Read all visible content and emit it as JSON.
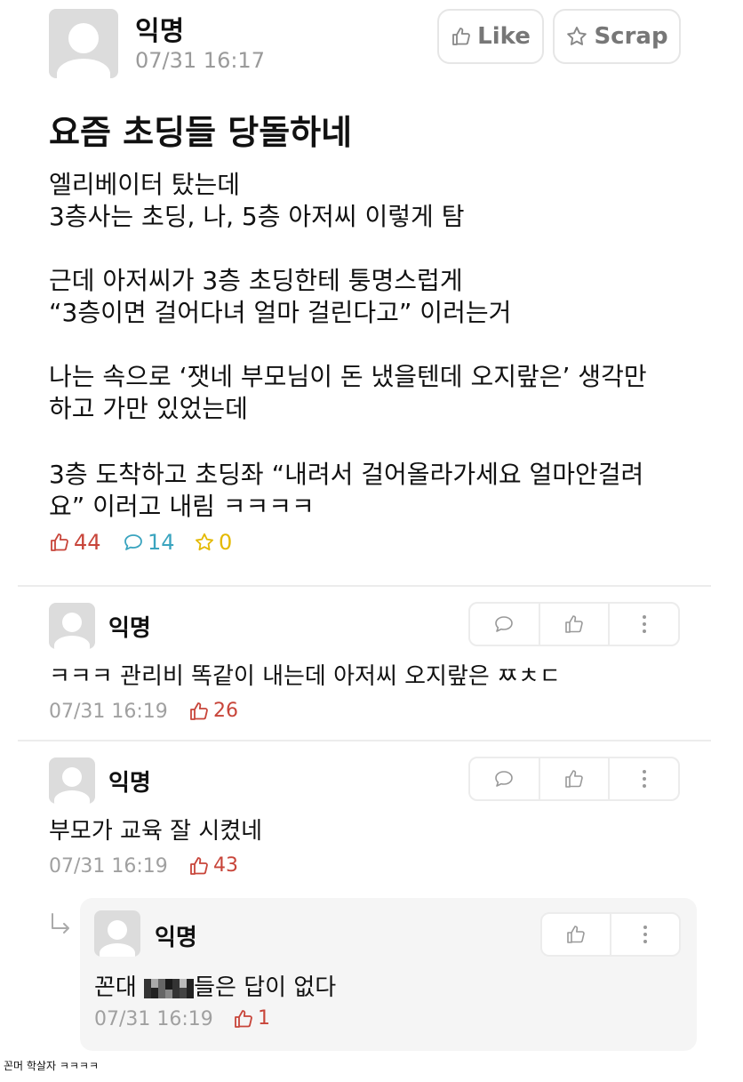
{
  "post": {
    "author": "익명",
    "time": "07/31 16:17",
    "like_button": "Like",
    "scrap_button": "Scrap",
    "title": "요즘 초딩들 당돌하네",
    "lines": [
      "엘리베이터 탔는데",
      "3층사는 초딩, 나, 5층 아저씨 이렇게 탐",
      "근데 아저씨가 3층 초딩한테 퉁명스럽게",
      "“3층이면 걸어다녀 얼마 걸린다고” 이러는거",
      "나는 속으로 ‘잿네 부모님이 돈 냈을텐데 오지랖은’ 생각만",
      "하고 가만 있었는데",
      "3층 도착하고 초딩좌 “내려서 걸어올라가세요 얼마안걸려",
      "요” 이러고 내림 ㅋㅋㅋㅋ"
    ],
    "stats": {
      "likes": "44",
      "comments": "14",
      "scraps": "0"
    }
  },
  "comments": [
    {
      "author": "익명",
      "text": "ㅋㅋㅋ 관리비 똑같이 내는데 아저씨 오지랖은 ㅉㅊㄷ",
      "time": "07/31 16:19",
      "likes": "26"
    },
    {
      "author": "익명",
      "text": "부모가 교육 잘 시켰네",
      "time": "07/31 16:19",
      "likes": "43"
    }
  ],
  "reply": {
    "author": "익명",
    "text_before": "꼰대 ",
    "text_after": "들은 답이 없다",
    "time": "07/31 16:19",
    "likes": "1"
  },
  "caption": "꼰머 학살자 ㅋㅋㅋㅋ",
  "colors": {
    "like_red": "#c8453a",
    "comment_teal": "#3aa4bf",
    "scrap_yellow": "#e4b900",
    "meta_gray": "#a0a0a0"
  },
  "icons": [
    "thumbs-up-icon",
    "star-icon",
    "speech-bubble-icon",
    "more-vertical-icon",
    "reply-arrow-icon"
  ]
}
